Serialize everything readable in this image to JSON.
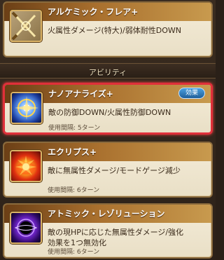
{
  "top_card": {
    "title": "アルケミック・フレア+",
    "desc": "火属性ダメージ(特大)/弱体耐性DOWN",
    "icon": "crossed-swords-icon"
  },
  "section_header": "アビリティ",
  "abilities": [
    {
      "title": "ナノアナライズ+",
      "badge": "効果",
      "desc": "敵の防御DOWN/火属性防御DOWN",
      "cooldown": "使用間隔: 5ターン",
      "icon": "analysis-burst-icon",
      "selected": true
    },
    {
      "title": "エクリプス+",
      "desc": "敵に無属性ダメージ/モードゲージ減少",
      "cooldown": "使用間隔: 6ターン",
      "icon": "eclipse-explosion-icon"
    },
    {
      "title": "アトミック・レゾリューション",
      "desc_line1": "敵の現HPに応じた無属性ダメージ/強化",
      "desc_line2": "効果を1つ無効化",
      "cooldown": "使用間隔: 6ターン",
      "icon": "black-hole-icon"
    }
  ]
}
